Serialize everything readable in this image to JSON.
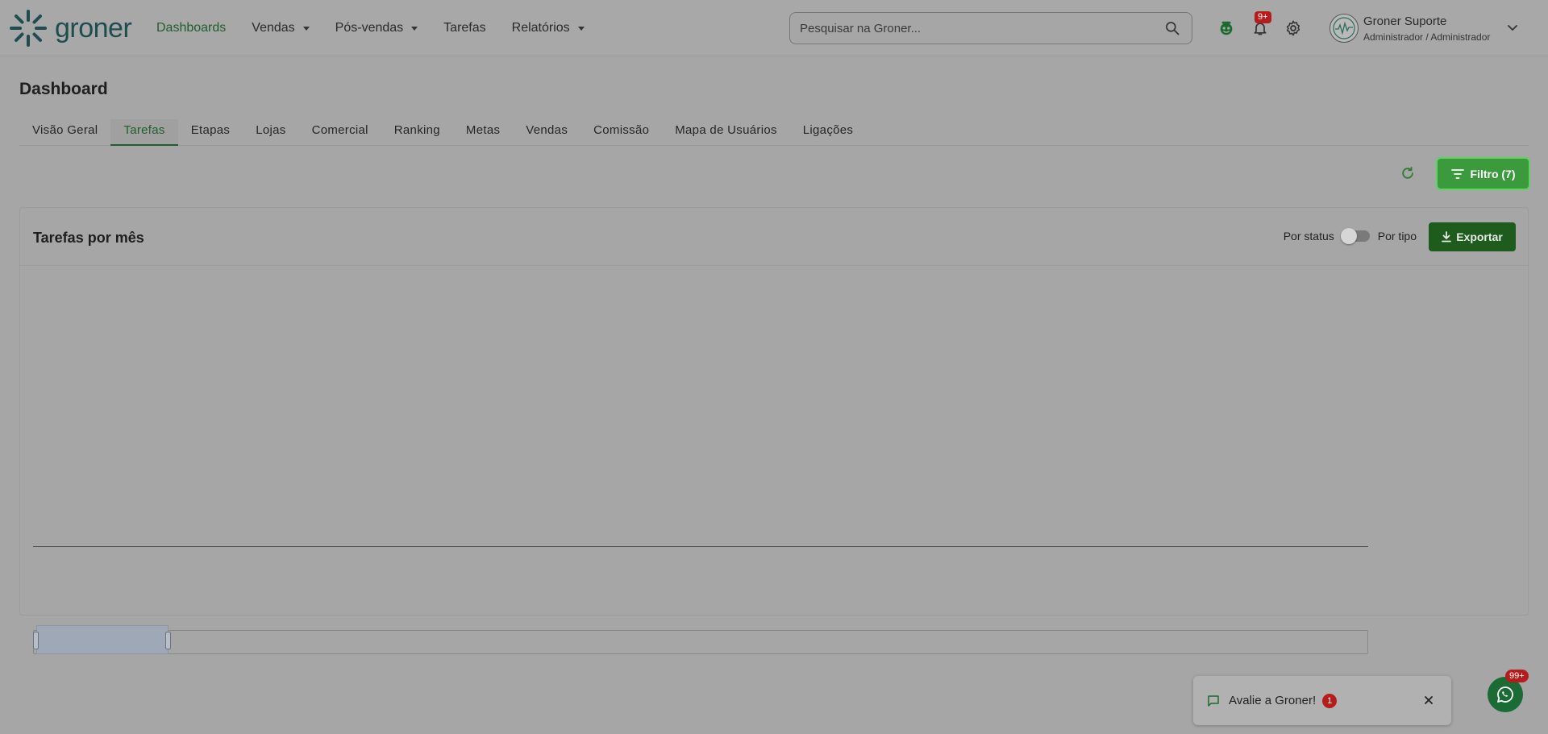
{
  "brand": {
    "name": "groner"
  },
  "nav": {
    "items": [
      {
        "label": "Dashboards",
        "active": true,
        "has_caret": false
      },
      {
        "label": "Vendas",
        "active": false,
        "has_caret": true
      },
      {
        "label": "Pós-vendas",
        "active": false,
        "has_caret": true
      },
      {
        "label": "Tarefas",
        "active": false,
        "has_caret": false
      },
      {
        "label": "Relatórios",
        "active": false,
        "has_caret": true
      }
    ]
  },
  "search": {
    "placeholder": "Pesquisar na Groner...",
    "value": ""
  },
  "notifications": {
    "badge": "9+"
  },
  "user": {
    "name": "Groner Suporte",
    "role": "Administrador / Administrador"
  },
  "page": {
    "title": "Dashboard"
  },
  "tabs": [
    {
      "label": "Visão Geral",
      "active": false
    },
    {
      "label": "Tarefas",
      "active": true
    },
    {
      "label": "Etapas",
      "active": false
    },
    {
      "label": "Lojas",
      "active": false
    },
    {
      "label": "Comercial",
      "active": false
    },
    {
      "label": "Ranking",
      "active": false
    },
    {
      "label": "Metas",
      "active": false
    },
    {
      "label": "Vendas",
      "active": false
    },
    {
      "label": "Comissão",
      "active": false
    },
    {
      "label": "Mapa de Usuários",
      "active": false
    },
    {
      "label": "Ligações",
      "active": false
    }
  ],
  "toolbar": {
    "filter_label": "Filtro (7)"
  },
  "card": {
    "title": "Tarefas por mês",
    "toggle_left": "Por status",
    "toggle_right": "Por tipo",
    "toggle_on": false,
    "export_label": "Exportar"
  },
  "toast": {
    "text": "Avalie a Groner!",
    "count": "1"
  },
  "whatsapp": {
    "badge": "99+"
  },
  "colors": {
    "accent": "#1f5f2a",
    "primary_button": "#3b9a3b",
    "export_button": "#1d5c1d",
    "badge": "#b71c1c"
  }
}
